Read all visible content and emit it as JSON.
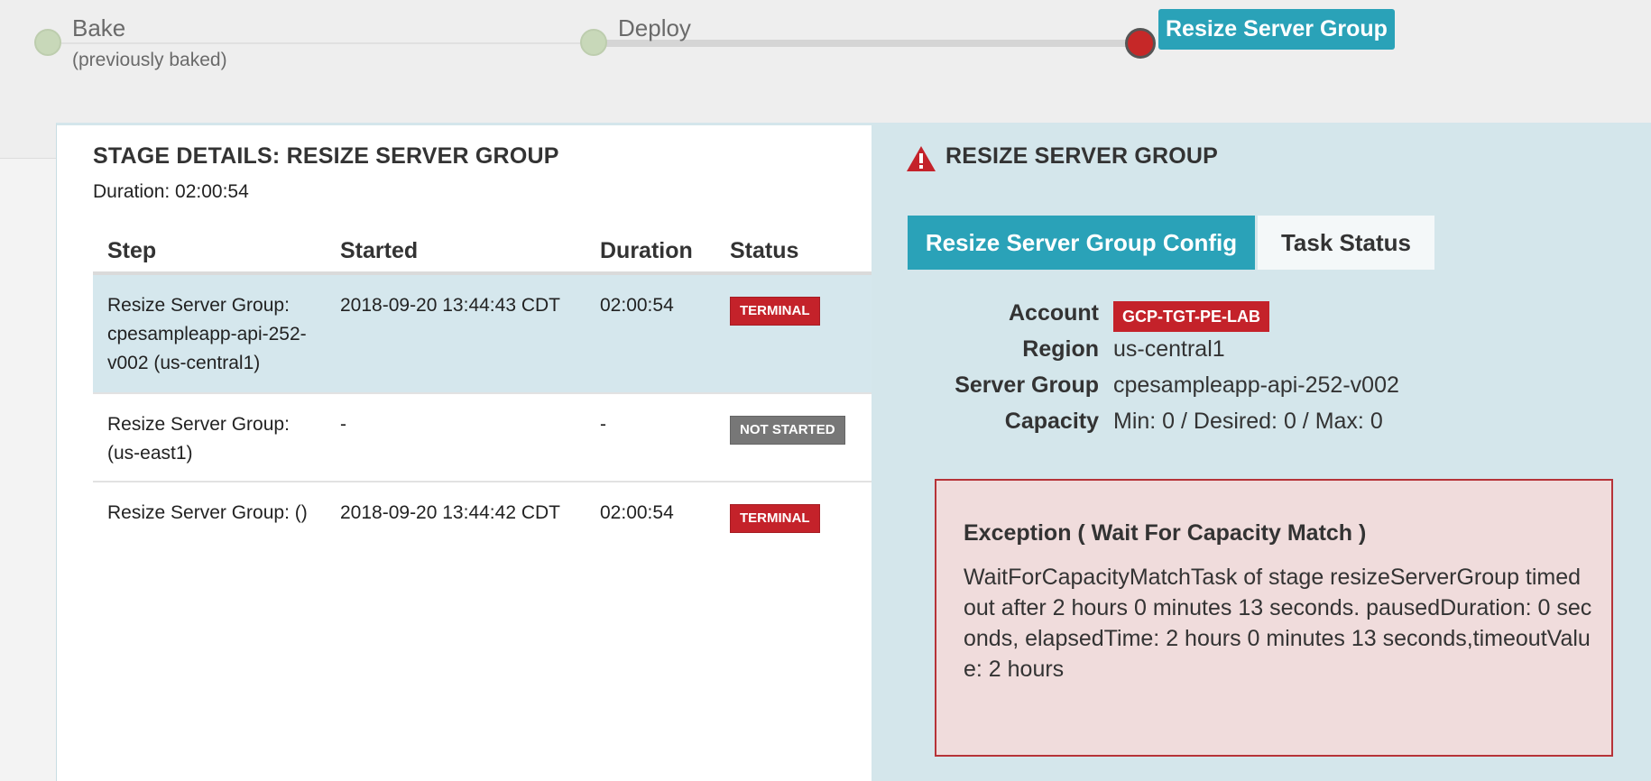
{
  "pipeline": {
    "stages": [
      {
        "name": "Bake",
        "sub": "(previously baked)",
        "status": "succeeded"
      },
      {
        "name": "Deploy",
        "status": "succeeded"
      },
      {
        "name": "Resize Server Group",
        "status": "terminal",
        "selected": true
      }
    ]
  },
  "stage_details": {
    "title": "STAGE DETAILS: RESIZE SERVER GROUP",
    "duration": "Duration: 02:00:54",
    "columns": [
      "Step",
      "Started",
      "Duration",
      "Status"
    ],
    "rows": [
      {
        "step": "Resize Server Group: cpesampleapp-api-252-v002 (us-central1)",
        "started": "2018-09-20 13:44:43 CDT",
        "duration": "02:00:54",
        "status": "TERMINAL"
      },
      {
        "step": "Resize Server Group: (us-east1)",
        "started": "-",
        "duration": "-",
        "status": "NOT STARTED"
      },
      {
        "step": "Resize Server Group: ()",
        "started": "2018-09-20 13:44:42 CDT",
        "duration": "02:00:54",
        "status": "TERMINAL"
      }
    ]
  },
  "detail_panel": {
    "title": "RESIZE SERVER GROUP",
    "icon": "warning-triangle-icon",
    "tabs": [
      "Resize Server Group Config",
      "Task Status"
    ],
    "fields": {
      "account_label": "Account",
      "account_value": "GCP-TGT-PE-LAB",
      "region_label": "Region",
      "region_value": "us-central1",
      "server_group_label": "Server Group",
      "server_group_value": "cpesampleapp-api-252-v002",
      "capacity_label": "Capacity",
      "capacity_value": "Min: 0 / Desired: 0 / Max: 0"
    },
    "exception": {
      "title": "Exception ( Wait For Capacity Match )",
      "message": "WaitForCapacityMatchTask of stage resizeServerGroup timed out after 2 hours 0 minutes 13 seconds. pausedDuration: 0 seconds, elapsedTime: 2 hours 0 minutes 13 seconds,timeoutValue: 2 hours"
    }
  },
  "colors": {
    "accent": "#2aa2b8",
    "terminal": "#c4222a",
    "not_started": "#777777",
    "stage_done": "#c8d8b9",
    "panel_bg": "#d4e6eb",
    "exception_bg": "#f0dcdc"
  }
}
